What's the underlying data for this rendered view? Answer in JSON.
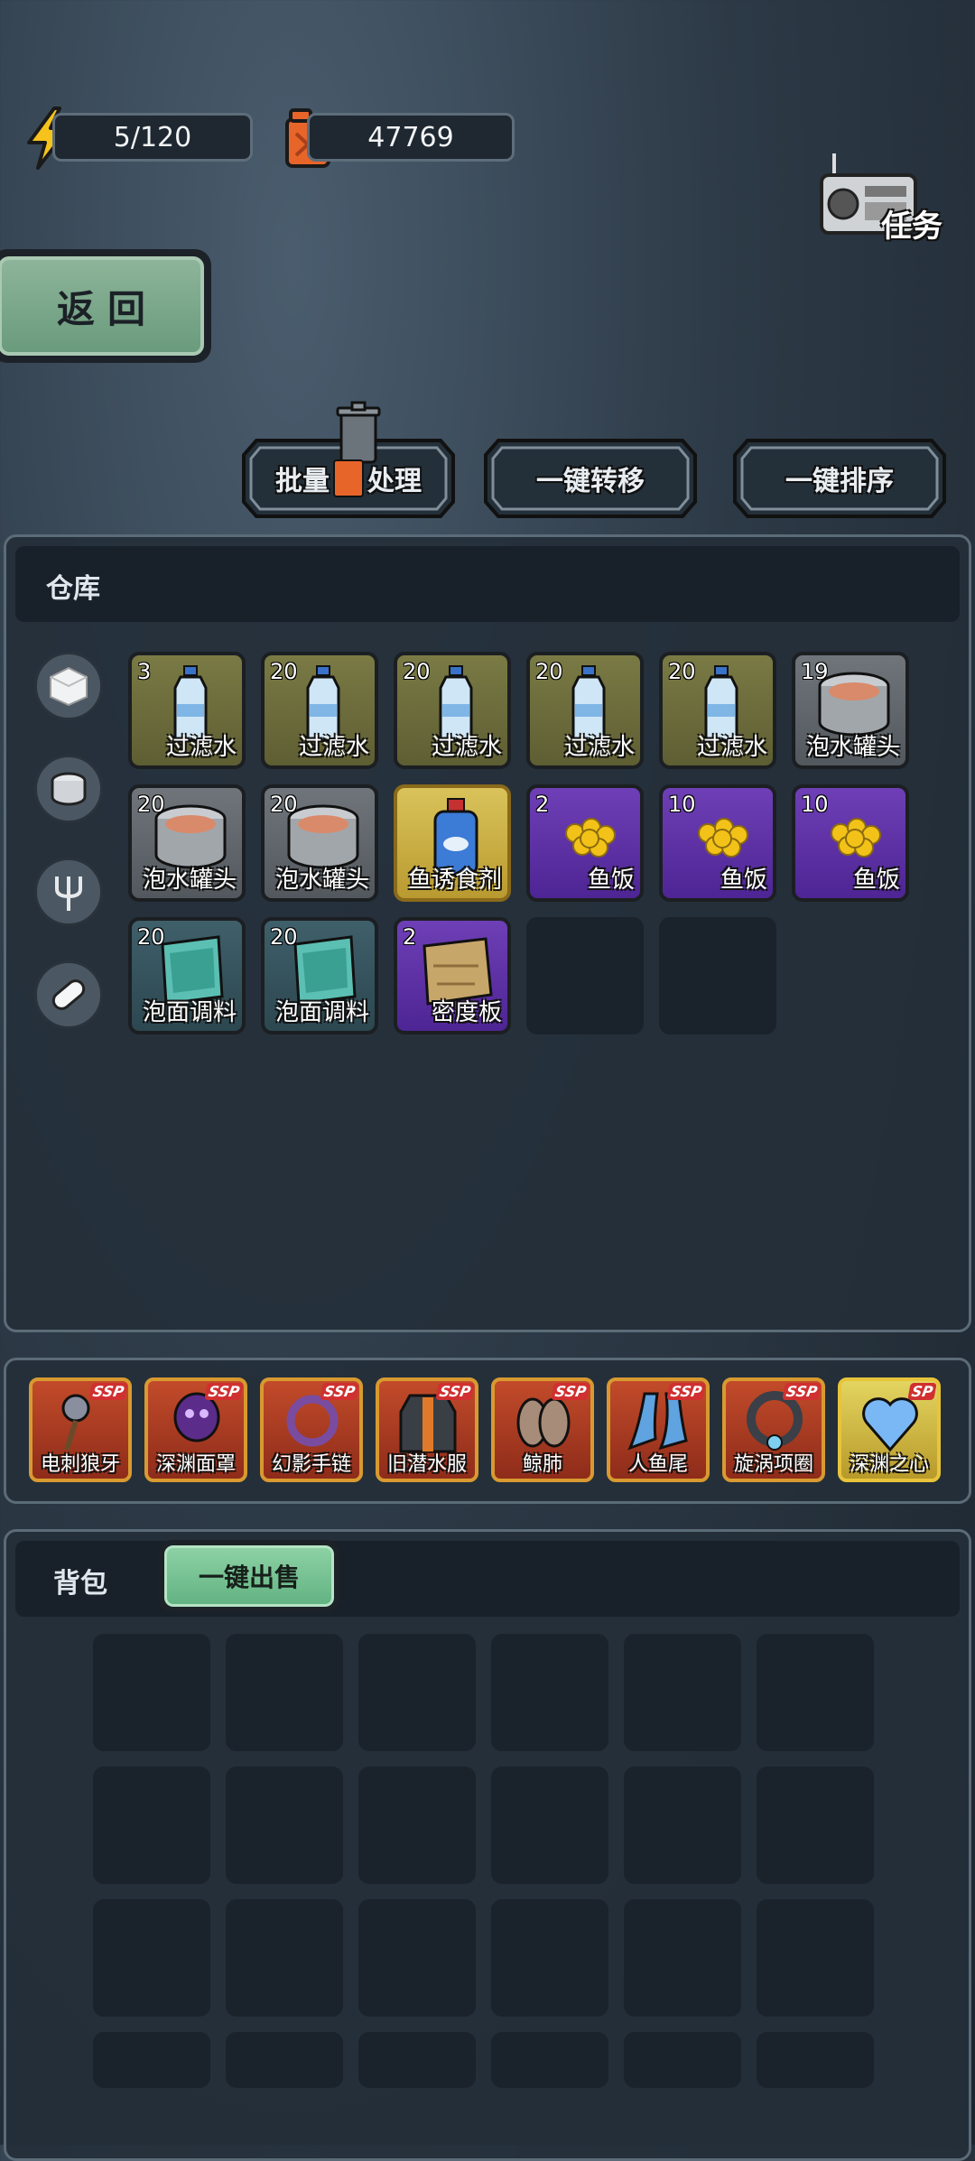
{
  "resources": {
    "energy": "5/120",
    "fuel": "47769"
  },
  "task_label": "任务",
  "back_label": "返回",
  "actions": {
    "batch_label_1": "批量",
    "batch_label_2": "处理",
    "transfer": "一键转移",
    "sort": "一键排序"
  },
  "warehouse": {
    "title": "仓库",
    "categories": [
      "box-icon",
      "can-icon",
      "fork-icon",
      "pill-icon"
    ],
    "items": [
      {
        "qty": "3",
        "name": "过滤水",
        "icon": "water-bottle-icon"
      },
      {
        "qty": "20",
        "name": "过滤水",
        "icon": "water-bottle-icon"
      },
      {
        "qty": "20",
        "name": "过滤水",
        "icon": "water-bottle-icon"
      },
      {
        "qty": "20",
        "name": "过滤水",
        "icon": "water-bottle-icon"
      },
      {
        "qty": "20",
        "name": "过滤水",
        "icon": "water-bottle-icon"
      },
      {
        "qty": "19",
        "name": "泡水罐头",
        "icon": "canned-fish-icon"
      },
      {
        "qty": "20",
        "name": "泡水罐头",
        "icon": "canned-fish-icon"
      },
      {
        "qty": "20",
        "name": "泡水罐头",
        "icon": "canned-fish-icon"
      },
      {
        "qty": "",
        "name": "鱼诱食剂",
        "icon": "fish-bait-bottle-icon"
      },
      {
        "qty": "2",
        "name": "鱼饭",
        "icon": "fish-feed-icon"
      },
      {
        "qty": "10",
        "name": "鱼饭",
        "icon": "fish-feed-icon"
      },
      {
        "qty": "10",
        "name": "鱼饭",
        "icon": "fish-feed-icon"
      },
      {
        "qty": "20",
        "name": "泡面调料",
        "icon": "seasoning-packet-icon"
      },
      {
        "qty": "20",
        "name": "泡面调料",
        "icon": "seasoning-packet-icon"
      },
      {
        "qty": "2",
        "name": "密度板",
        "icon": "board-icon"
      }
    ]
  },
  "equipment": [
    {
      "badge": "SSP",
      "name": "电刺狼牙",
      "icon": "spiked-mace-icon"
    },
    {
      "badge": "SSP",
      "name": "深渊面罩",
      "icon": "abyss-mask-icon"
    },
    {
      "badge": "SSP",
      "name": "幻影手链",
      "icon": "bracelet-icon"
    },
    {
      "badge": "SSP",
      "name": "旧潜水服",
      "icon": "diving-suit-icon"
    },
    {
      "badge": "SSP",
      "name": "鲸肺",
      "icon": "whale-lung-icon"
    },
    {
      "badge": "SSP",
      "name": "人鱼尾",
      "icon": "mermaid-tail-icon"
    },
    {
      "badge": "SSP",
      "name": "旋涡项圈",
      "icon": "vortex-collar-icon"
    },
    {
      "badge": "SP",
      "name": "深渊之心",
      "icon": "abyss-heart-icon"
    }
  ],
  "backpack": {
    "title": "背包",
    "sell_all": "一键出售"
  },
  "colors": {
    "panel": "#242f3a",
    "slot": "#1a232b",
    "green_button": "#6a9b7c",
    "ssp_frame": "#d89a30"
  }
}
